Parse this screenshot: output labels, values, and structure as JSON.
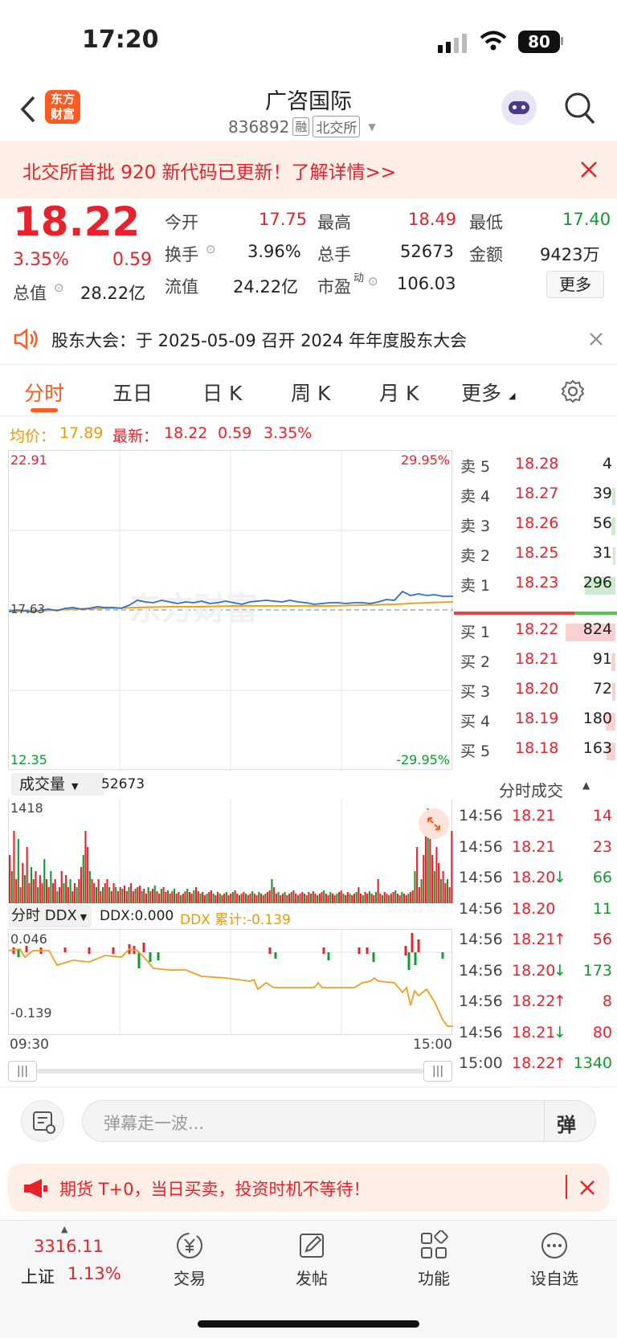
{
  "status": {
    "time": "17:20",
    "battery": "80"
  },
  "nav": {
    "title": "广咨国际",
    "code": "836892",
    "badge_rong": "融",
    "badge_exchange": "北交所",
    "logo_text": "东方财富"
  },
  "banner": {
    "text": "北交所首批 920 新代码已更新！了解详情>>"
  },
  "quote": {
    "price": "18.22",
    "pct": "3.35%",
    "change": "0.59",
    "open_label": "今开",
    "open": "17.75",
    "high_label": "最高",
    "high": "18.49",
    "low_label": "最低",
    "low": "17.40",
    "turnover_label": "换手",
    "turnover": "3.96%",
    "volume_label": "总手",
    "volume": "52673",
    "amount_label": "金额",
    "amount": "9423万",
    "mktcap_label": "总值",
    "mktcap": "28.22亿",
    "float_label": "流值",
    "float": "24.22亿",
    "pe_label": "市盈",
    "pe_sup": "动",
    "pe": "106.03",
    "more": "更多"
  },
  "notice": {
    "text": "股东大会：于 2025-05-09 召开 2024 年年度股东大会"
  },
  "tabs": [
    "分时",
    "五日",
    "日 K",
    "周 K",
    "月 K",
    "更多"
  ],
  "avg": {
    "avg_label": "均价：",
    "avg": "17.89",
    "latest_label": "最新：",
    "latest": "18.22",
    "chg": "0.59",
    "pct": "3.35%"
  },
  "price_chart": {
    "top_left": "22.91",
    "top_right": "29.95%",
    "bottom_left": "12.35",
    "bottom_right": "-29.95%",
    "mid_left": "17.63",
    "watermark": "东方财富"
  },
  "order_book": {
    "asks": [
      {
        "label": "卖 5",
        "price": "18.28",
        "vol": "4"
      },
      {
        "label": "卖 4",
        "price": "18.27",
        "vol": "39"
      },
      {
        "label": "卖 3",
        "price": "18.26",
        "vol": "56"
      },
      {
        "label": "卖 2",
        "price": "18.25",
        "vol": "31"
      },
      {
        "label": "卖 1",
        "price": "18.23",
        "vol": "296"
      }
    ],
    "bids": [
      {
        "label": "买 1",
        "price": "18.22",
        "vol": "824"
      },
      {
        "label": "买 2",
        "price": "18.21",
        "vol": "91"
      },
      {
        "label": "买 3",
        "price": "18.20",
        "vol": "72"
      },
      {
        "label": "买 4",
        "price": "18.19",
        "vol": "180"
      },
      {
        "label": "买 5",
        "price": "18.18",
        "vol": "163"
      }
    ]
  },
  "volume": {
    "selector": "成交量",
    "total": "52673",
    "max": "1418"
  },
  "ddx": {
    "selector": "分时 DDX",
    "ddx_text": "DDX:0.000",
    "ddx_cum": "DDX 累计:-0.139",
    "top": "0.046",
    "bottom": "-0.139",
    "time_start": "09:30",
    "time_end": "15:00"
  },
  "trades": {
    "title": "分时成交",
    "rows": [
      {
        "time": "14:56",
        "price": "18.21",
        "arrow": "",
        "vol": "14",
        "pc": "red",
        "vc": "red"
      },
      {
        "time": "14:56",
        "price": "18.21",
        "arrow": "",
        "vol": "23",
        "pc": "red",
        "vc": "red"
      },
      {
        "time": "14:56",
        "price": "18.20",
        "arrow": "↓",
        "vol": "66",
        "pc": "red",
        "vc": "green"
      },
      {
        "time": "14:56",
        "price": "18.20",
        "arrow": "",
        "vol": "11",
        "pc": "red",
        "vc": "green"
      },
      {
        "time": "14:56",
        "price": "18.21",
        "arrow": "↑",
        "vol": "56",
        "pc": "red",
        "vc": "red"
      },
      {
        "time": "14:56",
        "price": "18.20",
        "arrow": "↓",
        "vol": "173",
        "pc": "red",
        "vc": "green"
      },
      {
        "time": "14:56",
        "price": "18.22",
        "arrow": "↑",
        "vol": "8",
        "pc": "red",
        "vc": "red"
      },
      {
        "time": "14:56",
        "price": "18.21",
        "arrow": "↓",
        "vol": "80",
        "pc": "red",
        "vc": "red"
      },
      {
        "time": "15:00",
        "price": "18.22",
        "arrow": "↑",
        "vol": "1340",
        "pc": "red",
        "vc": "green"
      }
    ]
  },
  "comment": {
    "placeholder": "弹幕走一波...",
    "danmu": "弹"
  },
  "ad": {
    "text": "期货 T+0，当日买卖，投资时机不等待！"
  },
  "bottom": {
    "index_value": "3316.11",
    "index_name": "上证",
    "index_pct": "1.13%",
    "trade": "交易",
    "post": "发帖",
    "func": "功能",
    "watch": "设自选"
  },
  "colors": {
    "up": "#e8222d",
    "down": "#129a2d",
    "avg": "#f0a020",
    "price_line": "#2f6fd0",
    "accent": "#ff5a1f"
  }
}
